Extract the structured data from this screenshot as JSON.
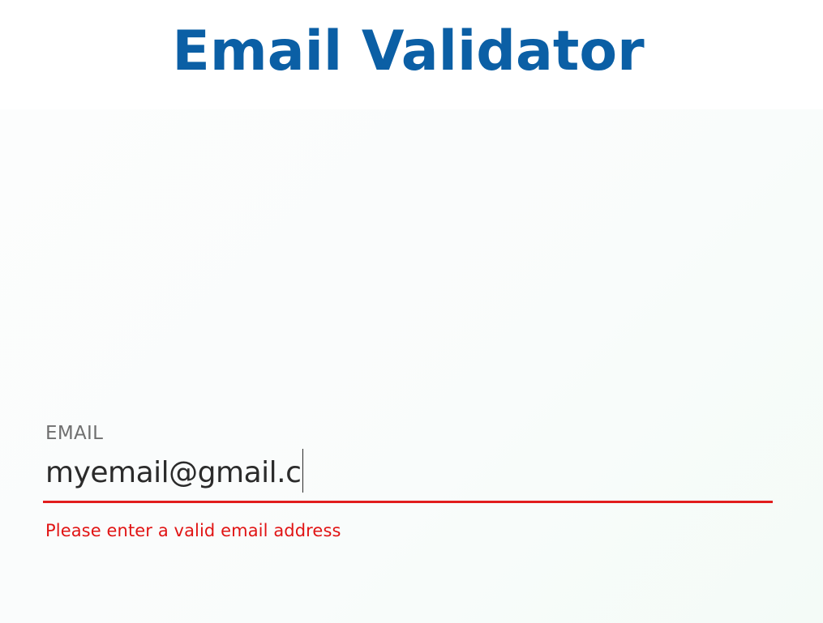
{
  "page": {
    "title": "Email Validator"
  },
  "form": {
    "email_label": "EMAIL",
    "email_value": "myemail@gmail.c",
    "error_message": "Please enter a valid email address"
  },
  "colors": {
    "title": "#0b5fa5",
    "error": "#e11414",
    "label": "#6f6f6f",
    "input_text": "#2b2b2b"
  }
}
